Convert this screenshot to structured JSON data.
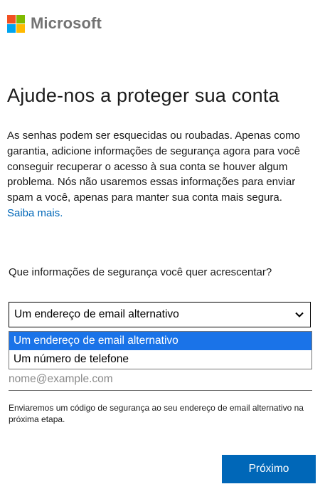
{
  "brand": {
    "name": "Microsoft",
    "logo_colors": [
      "#f25022",
      "#7fba00",
      "#00a4ef",
      "#ffb900"
    ]
  },
  "page": {
    "title": "Ajude-nos a proteger sua conta",
    "description": "As senhas podem ser esquecidas ou roubadas. Apenas como garantia, adicione informações de segurança agora para você conseguir recuperar o acesso à sua conta se houver algum problema. Nós não usaremos essas informações para enviar spam a você, apenas para manter sua conta mais segura.",
    "learn_more": "Saiba mais."
  },
  "form": {
    "question": "Que informações de segurança você quer acrescentar?",
    "select_value": "Um endereço de email alternativo",
    "options": [
      "Um endereço de email alternativo",
      "Um número de telefone"
    ],
    "email_placeholder": "nome@example.com",
    "hint": "Enviaremos um código de segurança ao seu endereço de email alternativo na próxima etapa."
  },
  "actions": {
    "next_label": "Próximo"
  },
  "colors": {
    "accent": "#0067b8",
    "selected_option": "#1a73e8"
  }
}
